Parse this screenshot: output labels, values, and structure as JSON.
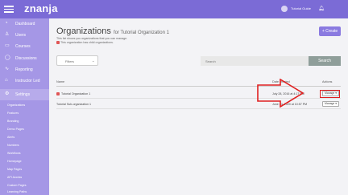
{
  "topbar": {
    "logo": "znanja",
    "user_name": "Tutorial Guide",
    "bell_icon": "bell-icon"
  },
  "sidebar": {
    "items": [
      {
        "icon": "dashboard-icon",
        "glyph": "◔",
        "label": "Dashboard"
      },
      {
        "icon": "users-icon",
        "glyph": "♙",
        "label": "Users"
      },
      {
        "icon": "courses-icon",
        "glyph": "▭",
        "label": "Courses"
      },
      {
        "icon": "discussions-icon",
        "glyph": "◯",
        "label": "Discussions"
      },
      {
        "icon": "reporting-icon",
        "glyph": "∿",
        "label": "Reporting"
      },
      {
        "icon": "instructor-led-icon",
        "glyph": "⌂",
        "label": "Instructor Led"
      },
      {
        "icon": "settings-icon",
        "glyph": "⚙",
        "label": "Settings"
      }
    ],
    "sub_items": [
      "Organizations",
      "Features",
      "Branding",
      "Demo Pages",
      "Alerts",
      "Numbers",
      "Workflows",
      "Homepage",
      "Map Pages",
      "API Access",
      "Custom Pages",
      "Learning Paths"
    ]
  },
  "main": {
    "title": "Organizations",
    "title_for": "for Tutorial Organization 1",
    "note1": "This list shows you organizations that you can manage.",
    "note2": "This organization has child organizations.",
    "create_label": "+ Create",
    "filters_label": "Filters",
    "search_placeholder": "Search",
    "search_label": "Search"
  },
  "table": {
    "headers": {
      "name": "Name",
      "date": "Date created",
      "actions": "Actions"
    },
    "rows": [
      {
        "name": "Tutorial Organization 1",
        "date": "July 28, 2016 at 4:17 PM",
        "action": "Manage ▾",
        "has_children": true
      },
      {
        "name": "Tutorial Sub-organization 1",
        "date": "June 24, 2020 at 10:57 PM",
        "action": "Manage ▾",
        "has_children": false
      }
    ]
  },
  "colors": {
    "topbar": "#7b6bd6",
    "sidebar": "#a597e6",
    "create_button": "#8a7ae0",
    "search_button": "#8f9e9a",
    "annotation": "#e02020"
  }
}
